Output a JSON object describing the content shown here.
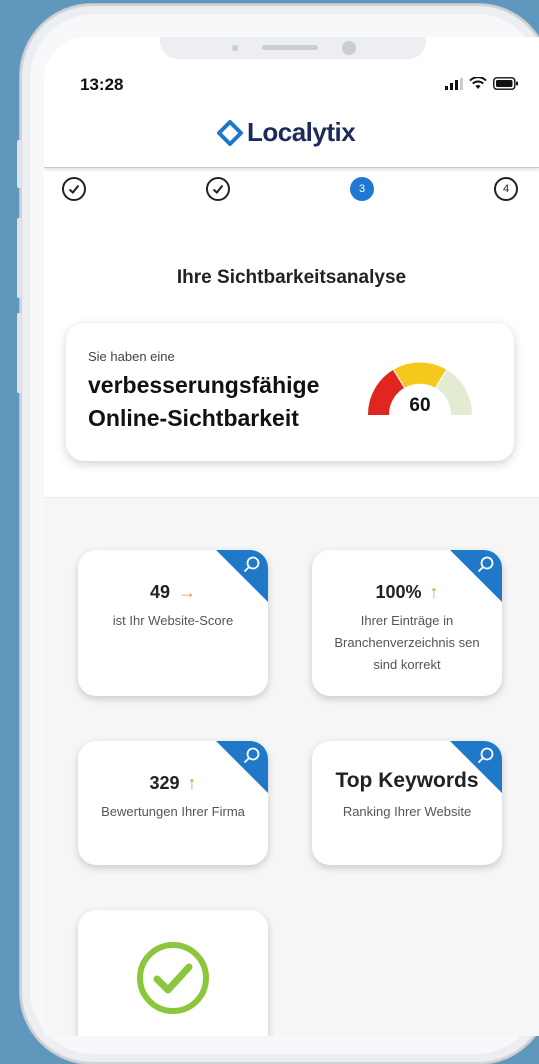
{
  "status": {
    "time": "13:28"
  },
  "app": {
    "brand": "Localytix"
  },
  "steps": [
    {
      "state": "done",
      "label": ""
    },
    {
      "state": "done",
      "label": ""
    },
    {
      "state": "active",
      "label": "3"
    },
    {
      "state": "todo",
      "label": "4"
    }
  ],
  "analysis": {
    "title": "Ihre Sichtbarkeitsanalyse",
    "pre": "Sie haben eine",
    "rating": "verbesserungsfähige Online-Sichtbarkeit",
    "score": "60",
    "score_value": 60
  },
  "tiles": [
    {
      "value": "49",
      "arrow": "→",
      "arrow_color": "#f0913a",
      "desc": "ist Ihr Website-Score"
    },
    {
      "value": "100%",
      "arrow": "↑",
      "arrow_color": "#8cc63f",
      "desc": "Ihrer Einträge in Branchenverzeichnis sen sind korrekt"
    },
    {
      "value": "329",
      "arrow": "↑",
      "arrow_color": "#8cc63f",
      "desc": "Bewertungen Ihrer Firma"
    },
    {
      "value": "Top Keywords",
      "arrow": "",
      "arrow_color": "",
      "desc": "Ranking Ihrer Website"
    }
  ],
  "colors": {
    "accent": "#1f78c8",
    "brand": "#1d2b5c",
    "gauge_red": "#e0261f",
    "gauge_yellow": "#f7c81c",
    "gauge_light": "#e3ecd3",
    "check_green": "#8cc63f"
  }
}
